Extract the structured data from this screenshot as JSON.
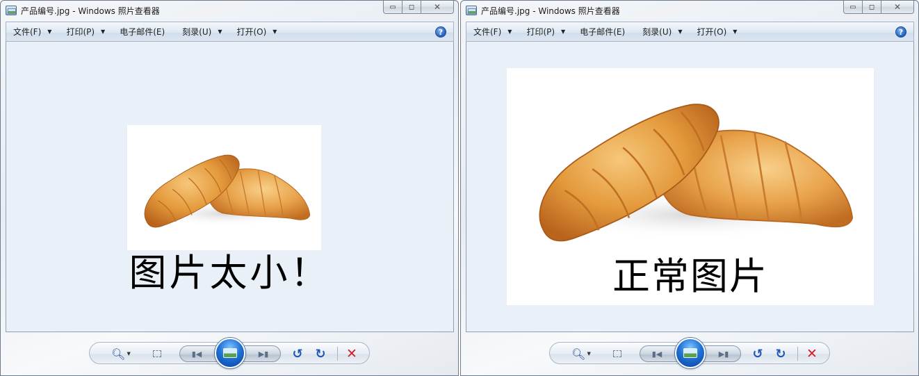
{
  "windows": [
    {
      "title": "产品编号.jpg - Windows 照片查看器",
      "menu": [
        {
          "label": "文件(F)",
          "has_arrow": true
        },
        {
          "label": "打印(P)",
          "has_arrow": true
        },
        {
          "label": "电子邮件(E)",
          "has_arrow": false
        },
        {
          "label": "刻录(U)",
          "has_arrow": true
        },
        {
          "label": "打开(O)",
          "has_arrow": true
        }
      ],
      "caption": "图片太小！"
    },
    {
      "title": "产品编号.jpg - Windows 照片查看器",
      "menu": [
        {
          "label": "文件(F)",
          "has_arrow": true
        },
        {
          "label": "打印(P)",
          "has_arrow": true
        },
        {
          "label": "电子邮件(E)",
          "has_arrow": false
        },
        {
          "label": "刻录(U)",
          "has_arrow": true
        },
        {
          "label": "打开(O)",
          "has_arrow": true
        }
      ],
      "caption": "正常图片"
    }
  ],
  "icons": {
    "app": "photo-viewer-icon",
    "help": "help-icon",
    "toolbar": [
      "zoom-icon",
      "actual-size-icon",
      "previous-icon",
      "slideshow-icon",
      "next-icon",
      "rotate-left-icon",
      "rotate-right-icon",
      "delete-icon"
    ]
  },
  "colors": {
    "viewport_bg": "#eaf0f7",
    "accent": "#1f72d6",
    "delete": "#d0202a"
  }
}
